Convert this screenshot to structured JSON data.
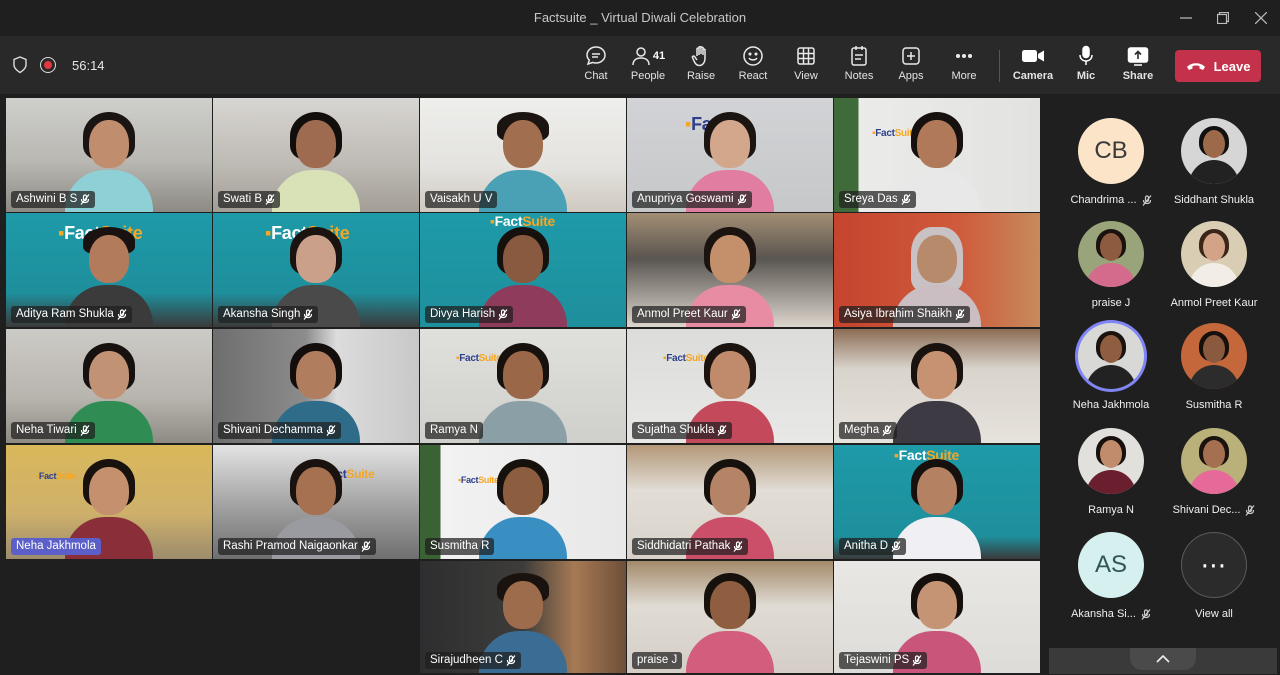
{
  "window": {
    "title": "Factsuite _ Virtual Diwali Celebration"
  },
  "toolbar": {
    "timer": "56:14",
    "people_count": "41",
    "buttons": {
      "chat": "Chat",
      "people": "People",
      "raise": "Raise",
      "react": "React",
      "view": "View",
      "notes": "Notes",
      "apps": "Apps",
      "more": "More",
      "camera": "Camera",
      "mic": "Mic",
      "share": "Share",
      "leave": "Leave"
    }
  },
  "brand": {
    "logo_fact": "Fact",
    "logo_suite": "Suite",
    "logo_fact_partial": "Fact",
    "logo_suite_partial": "Suite"
  },
  "grid": {
    "tiles": [
      {
        "name": "Ashwini B S"
      },
      {
        "name": "Swati B"
      },
      {
        "name": "Vaisakh U V"
      },
      {
        "name": "Anupriya  Goswami"
      },
      {
        "name": "Sreya Das"
      },
      {
        "name": "Aditya Ram Shukla"
      },
      {
        "name": "Akansha Singh"
      },
      {
        "name": "Divya Harish"
      },
      {
        "name": "Anmol Preet  Kaur"
      },
      {
        "name": "Asiya Ibrahim Shaikh"
      },
      {
        "name": "Neha  Tiwari"
      },
      {
        "name": "Shivani Dechamma"
      },
      {
        "name": "Ramya N"
      },
      {
        "name": "Sujatha Shukla"
      },
      {
        "name": "Megha"
      },
      {
        "name": "Neha  Jakhmola"
      },
      {
        "name": "Rashi Pramod Naigaonkar"
      },
      {
        "name": "Susmitha R"
      },
      {
        "name": "Siddhidatri  Pathak"
      },
      {
        "name": "Anitha D"
      },
      {
        "name": "Sirajudheen C"
      },
      {
        "name": "praise J"
      },
      {
        "name": "Tejaswini PS"
      }
    ]
  },
  "panel": {
    "participants": [
      {
        "name": "Chandrima ...",
        "initials": "CB"
      },
      {
        "name": "Siddhant Shukla"
      },
      {
        "name": "praise J"
      },
      {
        "name": "Anmol Preet Kaur"
      },
      {
        "name": "Neha Jakhmola"
      },
      {
        "name": "Susmitha R"
      },
      {
        "name": "Ramya N"
      },
      {
        "name": "Shivani Dec..."
      },
      {
        "name": "Akansha Si...",
        "initials": "AS"
      }
    ],
    "view_all": "View all",
    "view_all_glyph": "⋯"
  },
  "colors": {
    "leave": "#c4314b",
    "accent": "#7f85f5",
    "logo_blue": "#2d3e8c",
    "logo_orange": "#f5a623"
  }
}
